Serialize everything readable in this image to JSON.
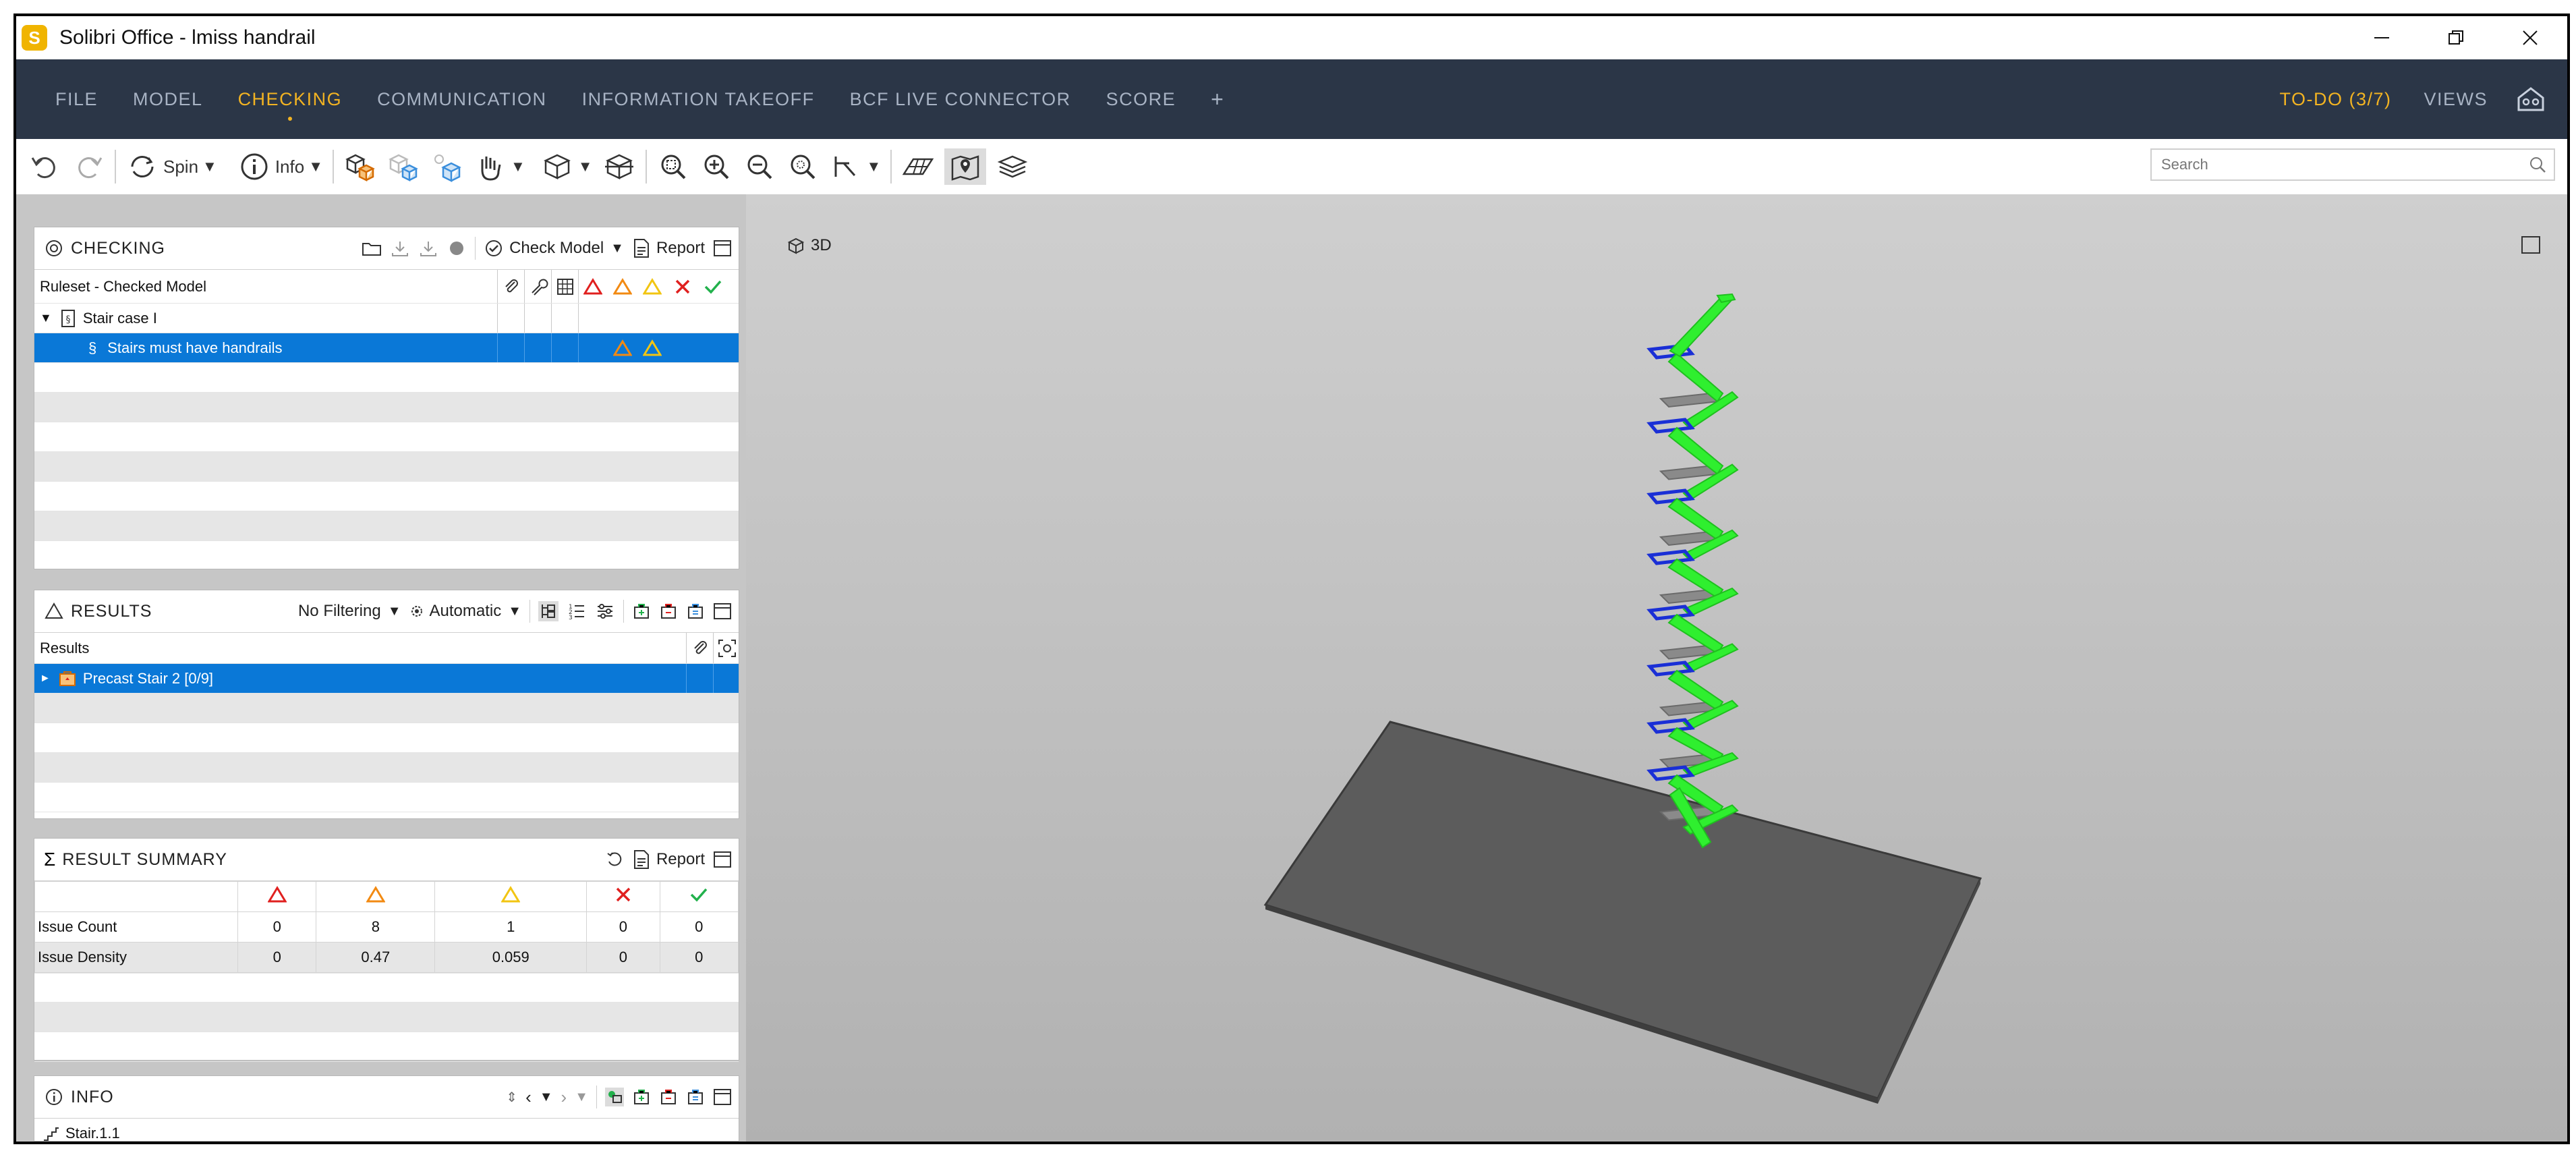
{
  "window": {
    "logo_letter": "S",
    "title": "Solibri Office - lmiss handrail"
  },
  "menu": {
    "items": [
      "FILE",
      "MODEL",
      "CHECKING",
      "COMMUNICATION",
      "INFORMATION TAKEOFF",
      "BCF LIVE CONNECTOR",
      "SCORE",
      "+"
    ],
    "active_index": 2,
    "todo": "TO-DO (3/7)",
    "views": "VIEWS"
  },
  "toolbar": {
    "spin_label": "Spin",
    "info_label": "Info",
    "search_placeholder": "Search"
  },
  "checking": {
    "title": "CHECKING",
    "check_model_label": "Check Model",
    "report_label": "Report",
    "column_header": "Ruleset - Checked Model",
    "ruleset": "Stair case I",
    "rule": "Stairs must have handrails"
  },
  "results": {
    "title": "RESULTS",
    "filter": "No Filtering",
    "mode": "Automatic",
    "column_header": "Results",
    "item": "Precast Stair 2 [0/9]"
  },
  "summary": {
    "title": "RESULT SUMMARY",
    "report_label": "Report",
    "rows": [
      {
        "label": "Issue Count",
        "values": [
          "0",
          "8",
          "1",
          "0",
          "0"
        ]
      },
      {
        "label": "Issue Density",
        "values": [
          "0",
          "0.47",
          "0.059",
          "0",
          "0"
        ]
      }
    ]
  },
  "info": {
    "title": "INFO",
    "item": "Stair.1.1"
  },
  "viewport": {
    "label": "3D"
  },
  "colors": {
    "menu_bg": "#2b3647",
    "accent": "#f2b322",
    "selection": "#0a78d7",
    "critical": "#e0201f",
    "moderate": "#f28a12",
    "low": "#f2c512",
    "rejected": "#e0201f",
    "ok": "#22b14c",
    "stair_green": "#2fef2f",
    "landing_blue": "#1a2fd6"
  }
}
